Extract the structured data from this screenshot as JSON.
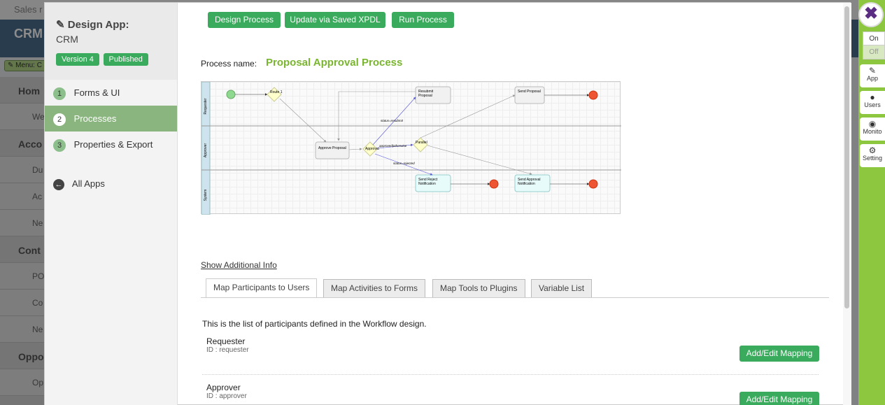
{
  "background": {
    "topbar_text": "Sales r",
    "header_title": "CRM",
    "menu_label": "Menu: C",
    "sidebar": [
      {
        "label": "Hom",
        "sub": false
      },
      {
        "label": "We",
        "sub": true
      },
      {
        "label": "Acco",
        "sub": false
      },
      {
        "label": "Du",
        "sub": true
      },
      {
        "label": "Ac",
        "sub": true
      },
      {
        "label": "Ne",
        "sub": true
      },
      {
        "label": "Cont",
        "sub": false
      },
      {
        "label": "PO",
        "sub": true
      },
      {
        "label": "Co",
        "sub": true
      },
      {
        "label": "Ne",
        "sub": true
      },
      {
        "label": "Oppo",
        "sub": false
      },
      {
        "label": "Op",
        "sub": true
      }
    ]
  },
  "right_panel": {
    "on_label": "On",
    "off_label": "Off",
    "items": [
      {
        "label": "App",
        "icon": "edit-icon"
      },
      {
        "label": "Users",
        "icon": "user-icon"
      },
      {
        "label": "Monito",
        "icon": "dashboard-icon"
      },
      {
        "label": "Setting",
        "icon": "cogs-icon"
      }
    ]
  },
  "nav": {
    "title": "Design App:",
    "app_name": "CRM",
    "version_badge": "Version 4",
    "published_badge": "Published",
    "items": [
      {
        "num": "1",
        "label": "Forms & UI"
      },
      {
        "num": "2",
        "label": "Processes"
      },
      {
        "num": "3",
        "label": "Properties & Export"
      }
    ],
    "all_apps": "All Apps"
  },
  "toolbar": {
    "design_process": "Design Process",
    "update_xpdl": "Update via Saved XPDL",
    "run_process": "Run Process"
  },
  "process": {
    "name_label": "Process name:",
    "name": "Proposal Approval Process"
  },
  "diagram": {
    "lanes": [
      "Requester",
      "Approver",
      "System"
    ],
    "nodes": [
      "Route 1",
      "Resubmit Proposal",
      "Send Proposal",
      "Approve Proposal",
      "Approval",
      "Parallel",
      "Send Reject Notification",
      "Send Approval Notification"
    ],
    "transitions": [
      "status=resubmit",
      "approved|otherwise",
      "status=rejected"
    ]
  },
  "show_info": "Show Additional Info",
  "tabs": [
    "Map Participants to Users",
    "Map Activities to Forms",
    "Map Tools to Plugins",
    "Variable List"
  ],
  "participants": {
    "description": "This is the list of participants defined in the Workflow design.",
    "list": [
      {
        "name": "Requester",
        "id": "ID : requester",
        "button": "Add/Edit Mapping"
      },
      {
        "name": "Approver",
        "id": "ID : approver",
        "button": "Add/Edit Mapping"
      }
    ]
  },
  "colors": {
    "accent_green": "#3aaa5c",
    "process_name": "#7ab530",
    "nav_active": "#8ab57f",
    "side_panel": "#8dc63f"
  }
}
